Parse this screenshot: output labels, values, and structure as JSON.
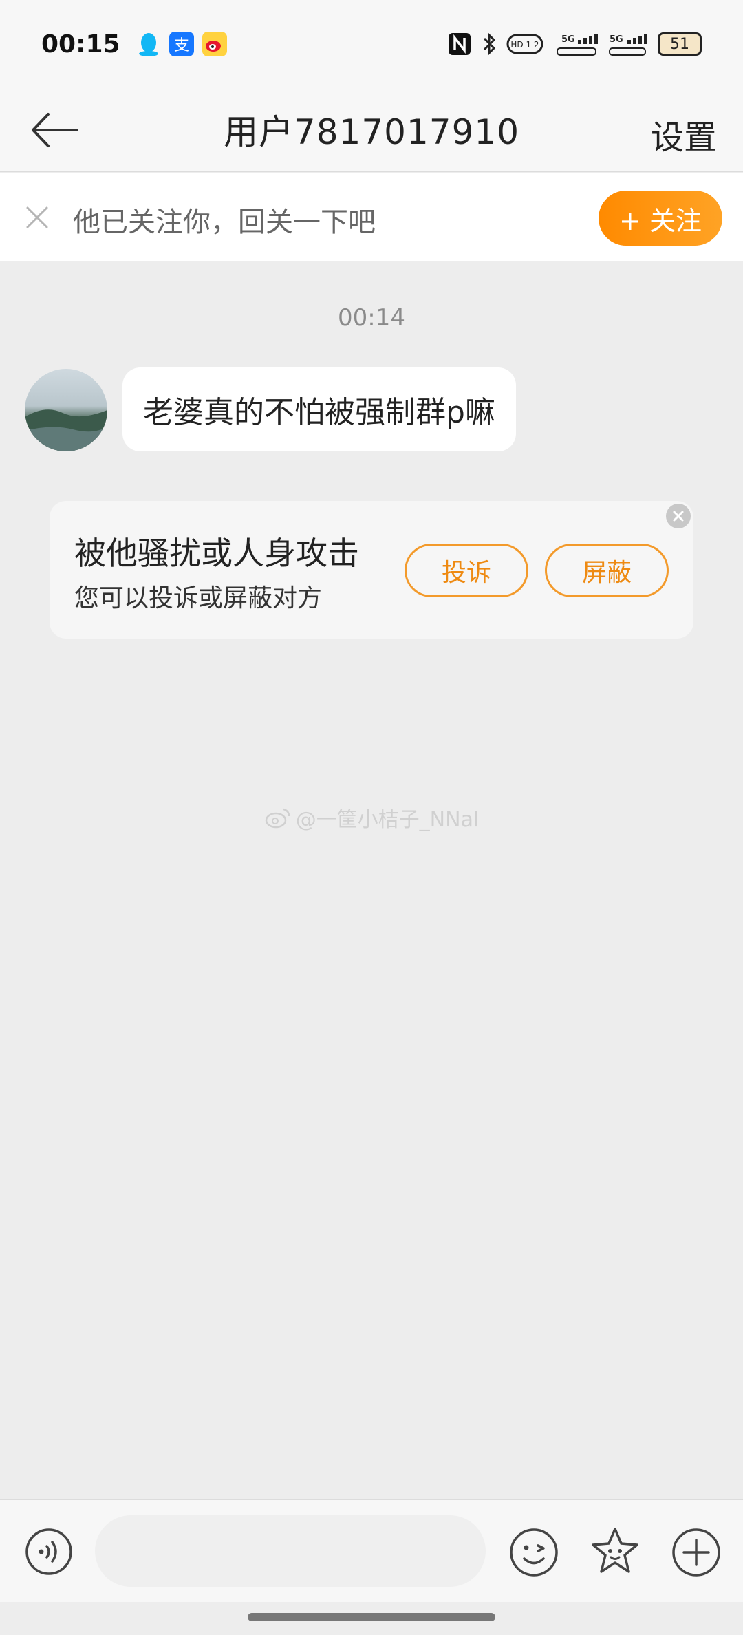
{
  "status_bar": {
    "time": "00:15",
    "apps": [
      "qq-icon",
      "alipay-icon",
      "weibo-icon"
    ],
    "alipay_glyph": "支",
    "system_icons": [
      "nfc-icon",
      "bluetooth-icon",
      "hd-icon",
      "signal-5g-icon",
      "signal-5g-icon"
    ],
    "hd_label": "HD 1 2",
    "net1": "5G",
    "net2": "5G",
    "battery": "51"
  },
  "header": {
    "title": "用户7817017910",
    "settings_label": "设置"
  },
  "follow_banner": {
    "text": "他已关注你，回关一下吧",
    "button_label": "+ 关注"
  },
  "chat": {
    "timestamp": "00:14",
    "messages": [
      {
        "sender": "other",
        "text": "老婆真的不怕被强制群p嘛"
      }
    ]
  },
  "report_card": {
    "title": "被他骚扰或人身攻击",
    "subtitle": "您可以投诉或屏蔽对方",
    "complain_label": "投诉",
    "block_label": "屏蔽"
  },
  "watermark": "@一筐小桔子_NNal",
  "input_bar": {
    "placeholder": ""
  },
  "colors": {
    "accent": "#ff8a00",
    "background": "#ededed",
    "bubble": "#ffffff"
  }
}
